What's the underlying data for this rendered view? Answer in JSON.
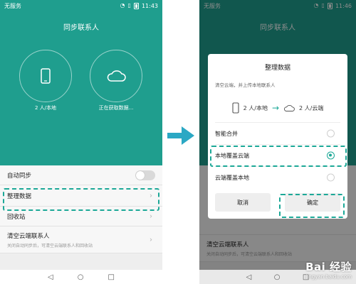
{
  "left": {
    "status": {
      "carrier": "无服务",
      "time": "11:43"
    },
    "title": "同步联系人",
    "local_caption": "2 人/本地",
    "cloud_caption": "正在获取数据...",
    "rows": {
      "auto_sync": "自动同步",
      "organize": "整理数据",
      "recycle": "回收站",
      "clear_title": "清空云端联系人",
      "clear_sub": "关闭自动同步后，可清空云端联系人和回收站"
    }
  },
  "right": {
    "status": {
      "carrier": "无服务",
      "time": "11:46"
    },
    "title": "同步联系人",
    "dialog": {
      "title": "整理数据",
      "description": "清空云端，并上传本地联系人",
      "from": "2 人/本地",
      "to": "2 人/云端",
      "options": [
        {
          "label": "智能合并",
          "selected": false
        },
        {
          "label": "本地覆盖云端",
          "selected": true
        },
        {
          "label": "云端覆盖本地",
          "selected": false
        }
      ],
      "cancel": "取消",
      "confirm": "确定"
    },
    "behind_row_title": "清空云端联系人",
    "behind_row_sub": "关闭自动同步后，可清空云端联系人和回收站"
  },
  "watermark": {
    "main": "Bai  经验",
    "sub": "jingyan.baidu.com"
  },
  "colors": {
    "accent": "#1f9e8e",
    "highlight": "#1ca897"
  },
  "icons": [
    "phone-icon",
    "cloud-icon",
    "arrow-right-icon",
    "chevron-right-icon",
    "wifi-icon",
    "sim-icon",
    "battery-icon",
    "back-icon",
    "home-icon",
    "recents-icon",
    "paw-icon"
  ]
}
